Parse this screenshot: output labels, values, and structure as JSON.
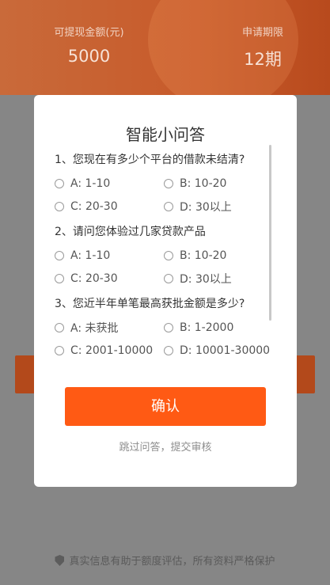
{
  "header": {
    "amount_label": "可提现金额(元)",
    "amount_value": "5000",
    "period_label": "申请期限",
    "period_value": "12期"
  },
  "footer_note": "真实信息有助于额度评估，所有资料严格保护",
  "modal": {
    "title": "智能小问答",
    "questions": [
      {
        "text": "1、您现在有多少个平台的借款未结清?",
        "options": [
          "A: 1-10",
          "B: 10-20",
          "C: 20-30",
          "D: 30以上"
        ]
      },
      {
        "text": "2、请问您体验过几家贷款产品",
        "options": [
          "A: 1-10",
          "B: 10-20",
          "C: 20-30",
          "D: 30以上"
        ]
      },
      {
        "text": "3、您近半年单笔最高获批金额是多少?",
        "options": [
          "A: 未获批",
          "B: 1-2000",
          "C: 2001-10000",
          "D: 10001-30000"
        ]
      }
    ],
    "confirm_label": "确认",
    "skip_label": "跳过问答，提交审核"
  }
}
